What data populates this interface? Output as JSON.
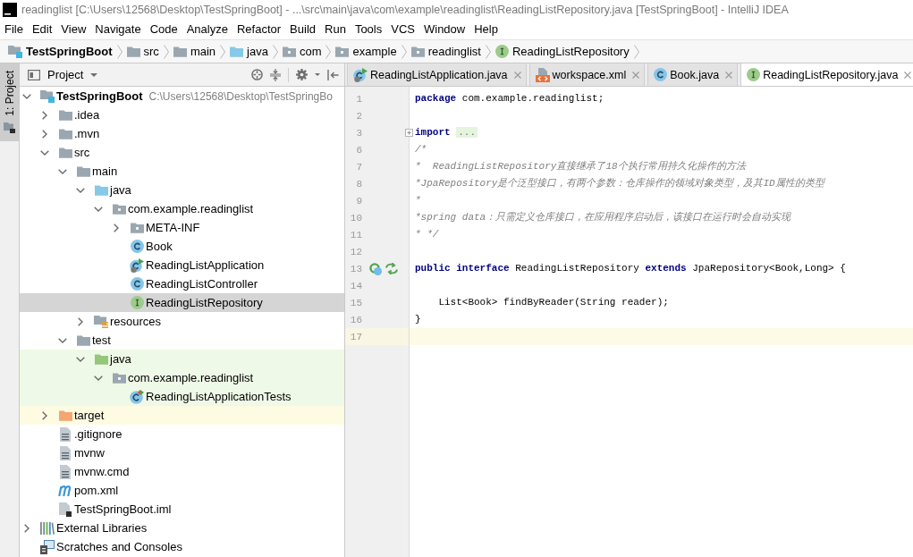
{
  "window": {
    "title": "readinglist [C:\\Users\\12568\\Desktop\\TestSpringBoot] - ...\\src\\main\\java\\com\\example\\readinglist\\ReadingListRepository.java [TestSpringBoot] - IntelliJ IDEA"
  },
  "menu": [
    "File",
    "Edit",
    "View",
    "Navigate",
    "Code",
    "Analyze",
    "Refactor",
    "Build",
    "Run",
    "Tools",
    "VCS",
    "Window",
    "Help"
  ],
  "breadcrumbs": [
    {
      "label": "TestSpringBoot",
      "kind": "module"
    },
    {
      "label": "src",
      "kind": "folder"
    },
    {
      "label": "main",
      "kind": "folder"
    },
    {
      "label": "java",
      "kind": "source-root"
    },
    {
      "label": "com",
      "kind": "package"
    },
    {
      "label": "example",
      "kind": "package"
    },
    {
      "label": "readinglist",
      "kind": "package"
    },
    {
      "label": "ReadingListRepository",
      "kind": "interface"
    }
  ],
  "tool_strip": {
    "tabs": [
      {
        "label": "1: Project",
        "selected": true
      }
    ]
  },
  "project_panel": {
    "title": "Project",
    "tree": [
      {
        "label": "TestSpringBoot",
        "detail": "C:\\Users\\12568\\Desktop\\TestSpringBo",
        "kind": "module",
        "expanded": true,
        "selected": false,
        "children": [
          {
            "label": ".idea",
            "kind": "folder",
            "expanded": false,
            "selected": false
          },
          {
            "label": ".mvn",
            "kind": "folder",
            "expanded": false,
            "selected": false
          },
          {
            "label": "src",
            "kind": "folder",
            "expanded": true,
            "selected": false,
            "children": [
              {
                "label": "main",
                "kind": "folder",
                "expanded": true,
                "selected": false,
                "children": [
                  {
                    "label": "java",
                    "kind": "source-root",
                    "expanded": true,
                    "selected": false,
                    "children": [
                      {
                        "label": "com.example.readinglist",
                        "kind": "package",
                        "expanded": true,
                        "selected": false,
                        "children": [
                          {
                            "label": "META-INF",
                            "kind": "package",
                            "expanded": false,
                            "selected": false
                          },
                          {
                            "label": "Book",
                            "kind": "class",
                            "selected": false
                          },
                          {
                            "label": "ReadingListApplication",
                            "kind": "app-class",
                            "selected": false
                          },
                          {
                            "label": "ReadingListController",
                            "kind": "class",
                            "selected": false
                          },
                          {
                            "label": "ReadingListRepository",
                            "kind": "interface",
                            "selected": true
                          }
                        ]
                      }
                    ]
                  },
                  {
                    "label": "resources",
                    "kind": "resources-root",
                    "expanded": false,
                    "selected": false
                  }
                ]
              },
              {
                "label": "test",
                "kind": "folder",
                "expanded": true,
                "selected": false,
                "children": [
                  {
                    "label": "java",
                    "kind": "test-root",
                    "expanded": true,
                    "selected": false,
                    "children": [
                      {
                        "label": "com.example.readinglist",
                        "kind": "package",
                        "expanded": true,
                        "selected": false,
                        "children": [
                          {
                            "label": "ReadingListApplicationTests",
                            "kind": "test-class",
                            "selected": false
                          }
                        ]
                      }
                    ]
                  }
                ]
              }
            ]
          },
          {
            "label": "target",
            "kind": "excluded",
            "expanded": false,
            "selected": false
          },
          {
            "label": ".gitignore",
            "kind": "file",
            "selected": false
          },
          {
            "label": "mvnw",
            "kind": "file",
            "selected": false
          },
          {
            "label": "mvnw.cmd",
            "kind": "file",
            "selected": false
          },
          {
            "label": "pom.xml",
            "kind": "maven",
            "selected": false
          },
          {
            "label": "TestSpringBoot.iml",
            "kind": "iml",
            "selected": false
          }
        ]
      },
      {
        "label": "External Libraries",
        "kind": "libraries",
        "expanded": false,
        "selected": false
      },
      {
        "label": "Scratches and Consoles",
        "kind": "scratches",
        "selected": false
      }
    ]
  },
  "editor": {
    "tabs": [
      {
        "label": "ReadingListApplication.java",
        "kind": "app-class",
        "selected": false
      },
      {
        "label": "workspace.xml",
        "kind": "xml",
        "selected": false
      },
      {
        "label": "Book.java",
        "kind": "class",
        "selected": false
      },
      {
        "label": "ReadingListRepository.java",
        "kind": "interface",
        "selected": true
      }
    ],
    "lines": [
      {
        "number": "1",
        "tokens": [
          {
            "kind": "keyword",
            "text": "package"
          },
          {
            "kind": "plain",
            "text": " com.example.readinglist;"
          }
        ],
        "current": false,
        "fold_marker": false,
        "gutter_icons": false
      },
      {
        "number": "2",
        "current": false,
        "fold_marker": false,
        "gutter_icons": false
      },
      {
        "number": "3",
        "tokens": [
          {
            "kind": "keyword",
            "text": "import"
          },
          {
            "kind": "folded",
            "text": "..."
          }
        ],
        "current": false,
        "fold_marker": true,
        "gutter_icons": false
      },
      {
        "number": "6",
        "tokens": [
          {
            "kind": "comment",
            "text": "/*"
          }
        ],
        "current": false,
        "fold_marker": false,
        "gutter_icons": false
      },
      {
        "number": "7",
        "tokens": [
          {
            "kind": "comment",
            "text": "*  ReadingListRepository直接继承了18个执行常用持久化操作的方法"
          }
        ],
        "current": false,
        "fold_marker": false,
        "gutter_icons": false
      },
      {
        "number": "8",
        "tokens": [
          {
            "kind": "comment",
            "text": "*JpaRepository是个泛型接口，有两个参数：仓库操作的领域对象类型，及其ID属性的类型"
          }
        ],
        "current": false,
        "fold_marker": false,
        "gutter_icons": false
      },
      {
        "number": "9",
        "tokens": [
          {
            "kind": "comment",
            "text": "*"
          }
        ],
        "current": false,
        "fold_marker": false,
        "gutter_icons": false
      },
      {
        "number": "10",
        "tokens": [
          {
            "kind": "comment",
            "text": "*spring data：只需定义仓库接口，在应用程序启动后，该接口在运行时会自动实现"
          }
        ],
        "current": false,
        "fold_marker": false,
        "gutter_icons": false
      },
      {
        "number": "11",
        "tokens": [
          {
            "kind": "comment",
            "text": "* */"
          }
        ],
        "current": false,
        "fold_marker": false,
        "gutter_icons": false
      },
      {
        "number": "12",
        "current": false,
        "fold_marker": false,
        "gutter_icons": false
      },
      {
        "number": "13",
        "tokens": [
          {
            "kind": "keyword",
            "text": "public interface"
          },
          {
            "kind": "plain",
            "text": " ReadingListRepository "
          },
          {
            "kind": "keyword",
            "text": "extends"
          },
          {
            "kind": "plain",
            "text": " JpaRepository<Book,Long> {"
          }
        ],
        "current": false,
        "fold_marker": false,
        "gutter_icons": true
      },
      {
        "number": "14",
        "current": false,
        "fold_marker": false,
        "gutter_icons": false
      },
      {
        "number": "15",
        "tokens": [
          {
            "kind": "plain",
            "text": "    List<Book> findByReader(String reader);"
          }
        ],
        "current": false,
        "fold_marker": false,
        "gutter_icons": false
      },
      {
        "number": "16",
        "tokens": [
          {
            "kind": "plain",
            "text": "}"
          }
        ],
        "current": false,
        "fold_marker": false,
        "gutter_icons": false
      },
      {
        "number": "17",
        "current": true,
        "fold_marker": false,
        "gutter_icons": false
      }
    ]
  }
}
